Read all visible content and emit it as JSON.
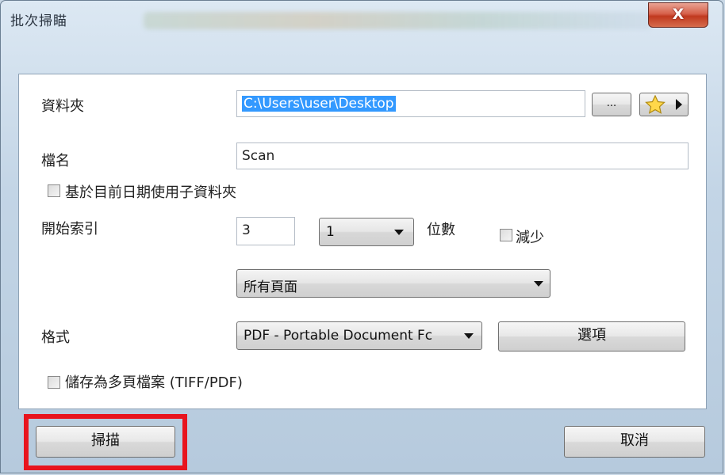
{
  "window": {
    "title": "批次掃瞄",
    "close_label": "X"
  },
  "folder": {
    "label": "資料夾",
    "value": "C:\\Users\\user\\Desktop",
    "browse_label": "...",
    "favorites_icon": "star-icon"
  },
  "filename": {
    "label": "檔名",
    "value": "Scan"
  },
  "subfolder_option": {
    "label": "基於目前日期使用子資料夾",
    "checked": false
  },
  "start_index": {
    "label": "開始索引",
    "value": "3",
    "digits_value": "1",
    "digits_label": "位數",
    "decrease_label": "減少",
    "decrease_checked": false
  },
  "pages": {
    "value": "所有頁面"
  },
  "format": {
    "label": "格式",
    "value": "PDF - Portable Document Fc",
    "options_label": "選項"
  },
  "multipage_option": {
    "label": "儲存為多頁檔案 (TIFF/PDF)",
    "checked": false
  },
  "footer": {
    "scan_label": "掃描",
    "cancel_label": "取消"
  },
  "colors": {
    "highlight": "#e8141e",
    "selection": "#3399ff"
  }
}
